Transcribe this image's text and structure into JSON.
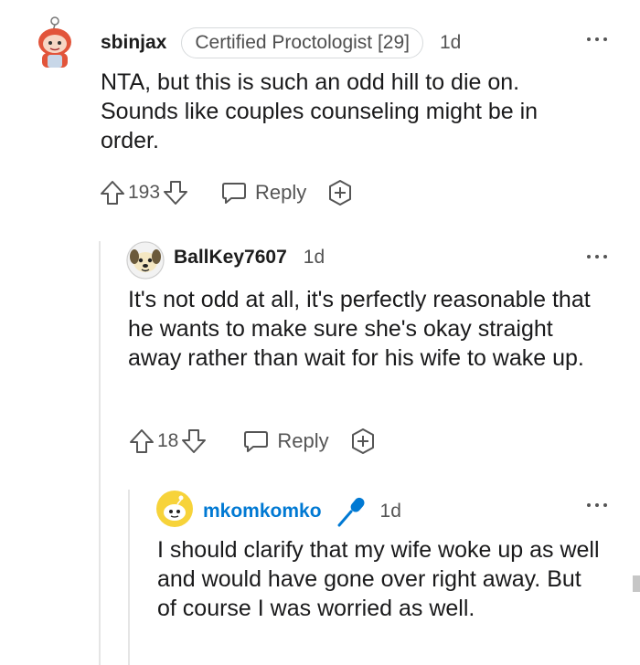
{
  "comments": [
    {
      "username": "sbinjax",
      "flair": "Certified Proctologist [29]",
      "time": "1d",
      "body": "NTA, but this is such an odd hill to die on. Sounds like couples counseling might be in order.",
      "score": "193",
      "reply_label": "Reply",
      "avatar_icon": "redhead-snoo-avatar-icon"
    },
    {
      "username": "BallKey7607",
      "time": "1d",
      "body": "It's not odd at all, it's perfectly reasonable that he wants to make sure she's okay straight away rather than wait for his wife to wake up.",
      "score": "18",
      "reply_label": "Reply",
      "avatar_icon": "dog-snoo-avatar-icon"
    },
    {
      "username": "mkomkomko",
      "op_badge_icon": "microphone-icon",
      "time": "1d",
      "body": "I should clarify that my wife woke up as well and would have gone over right away. But of course I was worried as well.",
      "avatar_icon": "yellow-snoo-avatar-icon"
    }
  ],
  "colors": {
    "op_username": "#0079d3",
    "text": "#1a1a1b",
    "muted": "#555555",
    "thread_line": "#e5e5e5"
  }
}
